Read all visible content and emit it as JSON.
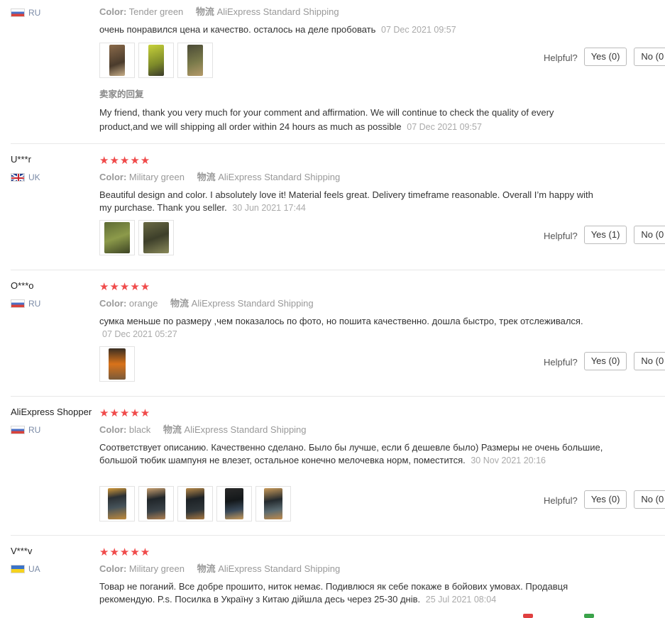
{
  "helpful_label": "Helpful?",
  "labels": {
    "color": "Color:",
    "shipping": "物流"
  },
  "reviews": [
    {
      "user": "",
      "country": "RU",
      "color": "Tender green",
      "shipping": "AliExpress Standard Shipping",
      "text": "очень понравился цена и качество. осталось на деле пробовать",
      "date": "07 Dec 2021 09:57",
      "yes": "Yes (0)",
      "no": "No (0",
      "reply_title": "卖家的回复",
      "reply_text": "My friend, thank you very much for your comment and affirmation. We will continue to check the quality of every product,and we will shipping all order within 24 hours as much as possible",
      "reply_date": "07 Dec 2021 09:57"
    },
    {
      "user": "U***r",
      "country": "UK",
      "stars": "★★★★★",
      "color": "Military green",
      "shipping": "AliExpress Standard Shipping",
      "text": "Beautiful design and color. I absolutely love it! Material feels great. Delivery timeframe reasonable. Overall I’m happy with my purchase. Thank you seller.",
      "date": "30 Jun 2021 17:44",
      "yes": "Yes (1)",
      "no": "No (0"
    },
    {
      "user": "O***o",
      "country": "RU",
      "stars": "★★★★★",
      "color": "orange",
      "shipping": "AliExpress Standard Shipping",
      "text": "сумка меньше по размеру ,чем показалось по фото, но пошита качественно. дошла быстро, трек отслеживался.",
      "date": "07 Dec 2021 05:27",
      "yes": "Yes (0)",
      "no": "No (0"
    },
    {
      "user": "AliExpress Shopper",
      "country": "RU",
      "stars": "★★★★★",
      "color": "black",
      "shipping": "AliExpress Standard Shipping",
      "text": "Соответствует описанию. Качественно сделано. Было бы лучше, если б дешевле было) Размеры не очень большие, большой тюбик шампуня не влезет, остальное конечно мелочевка норм, поместится.",
      "date": "30 Nov 2021 20:16",
      "yes": "Yes (0)",
      "no": "No (0"
    },
    {
      "user": "V***v",
      "country": "UA",
      "stars": "★★★★★",
      "color": "Military green",
      "shipping": "AliExpress Standard Shipping",
      "text": "Товар не поганий. Все добре прошито, ниток немає. Подивлюся як себе покаже в бойових умовах. Продавця рекомендую. P.s. Посилка в Україну з Китаю дійшла десь через 25-30 днів.",
      "date": "25 Jul 2021 08:04"
    }
  ],
  "colors": {
    "star": "#f04b4b",
    "photo_green": "#6f7a3a",
    "photo_yellow": "#c7d13a",
    "photo_orange": "#d9731a",
    "photo_dark": "#2b3034"
  }
}
